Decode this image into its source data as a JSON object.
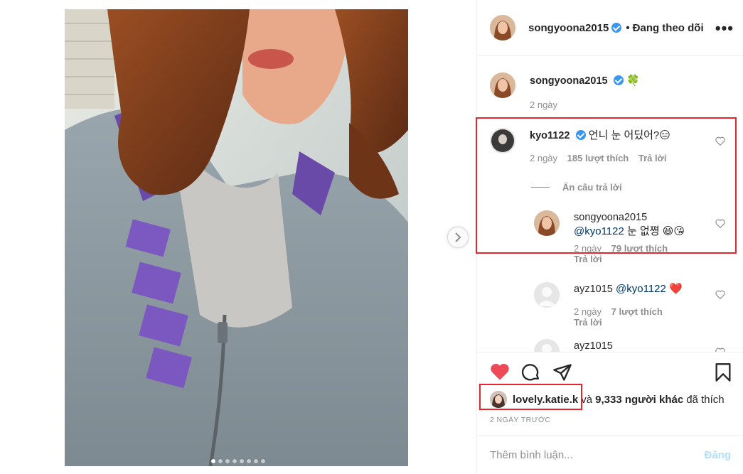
{
  "colors": {
    "accent": "#3897f0",
    "like_red": "#ed4956",
    "highlight_box": "#e8242c",
    "muted": "#8e8e8e",
    "post_disabled": "#b2dffc"
  },
  "media": {
    "carousel": {
      "count": 8,
      "active_index": 0
    },
    "next_icon": "chevron-right-icon"
  },
  "header": {
    "username": "songyoona2015",
    "separator": "•",
    "follow_status": "Đang theo dõi",
    "more_icon": "more-horizontal-icon",
    "more_label": "•••"
  },
  "caption": {
    "username": "songyoona2015",
    "emoji": "🍀",
    "time": "2 ngày"
  },
  "comments": [
    {
      "username": "kyo1122",
      "verified": true,
      "text": "언니 눈 어딨어?",
      "emoji": "😑",
      "time": "2 ngày",
      "likes": "185 lượt thích",
      "reply_label": "Trả lời",
      "toggle_replies": "Ẩn câu trả lời",
      "replies": [
        {
          "username": "songyoona2015",
          "mention": "@kyo1122",
          "text": "눈 없쪙",
          "emoji": "😆😘",
          "time": "2 ngày",
          "likes": "79 lượt thích",
          "reply_label": "Trả lời"
        },
        {
          "username": "ayz1015",
          "mention": "@kyo1122",
          "emoji": "❤️",
          "time": "2 ngày",
          "likes": "7 lượt thích",
          "reply_label": "Trả lời"
        },
        {
          "username": "ayz1015"
        }
      ]
    }
  ],
  "actions": {
    "like_icon": "heart-filled-icon",
    "comment_icon": "comment-icon",
    "share_icon": "share-icon",
    "save_icon": "bookmark-icon",
    "liked_by_user": "lovely.katie.k",
    "liked_by_connector": "và",
    "liked_others": "9,333 người khác",
    "liked_suffix": "đã thích",
    "timestamp": "2 NGÀY TRƯỚC"
  },
  "comment_box": {
    "placeholder": "Thêm bình luận...",
    "post_label": "Đăng"
  }
}
